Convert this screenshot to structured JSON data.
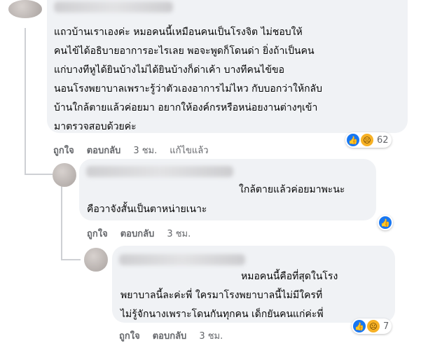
{
  "comments": [
    {
      "text_lines": [
        "แถวบ้านเราเองค่ะ หมอคนนี้เหมือนคนเป็นโรงจิต ไม่ชอบให้",
        "คนไข้ได้อธิบายอาการอะไรเลย พอจะพูดก็โดนด่า ยิ่งถ้าเป็นคน",
        "แก่บางทีหูได้ยินบ้างไม่ได้ยินบ้างก็ด่าเค้า บางทีคนไข้ขอ",
        "นอนโรงพยาบาลเพราะรู้ว่าตัวเองอาการไม่ไหว กับบอกว่าให้กลับ",
        "บ้านใกล้ตายแล้วค่อยมา อยากให้องค์กรหรือหน่อยงานต่างๆเข้า",
        "มาตรวจสอบด้วยค่ะ"
      ],
      "like_label": "ถูกใจ",
      "reply_label": "ตอบกลับ",
      "time": "3 ชม.",
      "edited_label": "แก้ไขแล้ว",
      "reaction_count": "62",
      "reactions": [
        "like-icon",
        "sad-icon"
      ]
    },
    {
      "text_lines": [
        "ใกล้ตายแล้วค่อยมาพะนะ",
        "คือวาจังสั้นเป็นตาหน่ายเนาะ"
      ],
      "like_label": "ถูกใจ",
      "reply_label": "ตอบกลับ",
      "time": "3 ชม.",
      "reactions": [
        "like-icon"
      ]
    },
    {
      "text_lines": [
        "หมอคนนี้คือที่สุดในโรง",
        "พยาบาลนี้ละค่ะพี่ ใครมาโรงพยาบาลนี้ไม่มีใครที่",
        "ไม่รู้จักนางเพราะโดนกันทุกคน เด็กยันคนแก่ค่ะพี่"
      ],
      "like_label": "ถูกใจ",
      "reply_label": "ตอบกลับ",
      "time": "3 ชม.",
      "reaction_count": "7",
      "reactions": [
        "like-icon",
        "sad-icon"
      ]
    }
  ],
  "colors": {
    "bubble": "#f0f2f5",
    "meta_text": "#65676b",
    "like_blue": "#1877f2",
    "sad_yellow": "#f7b125"
  }
}
